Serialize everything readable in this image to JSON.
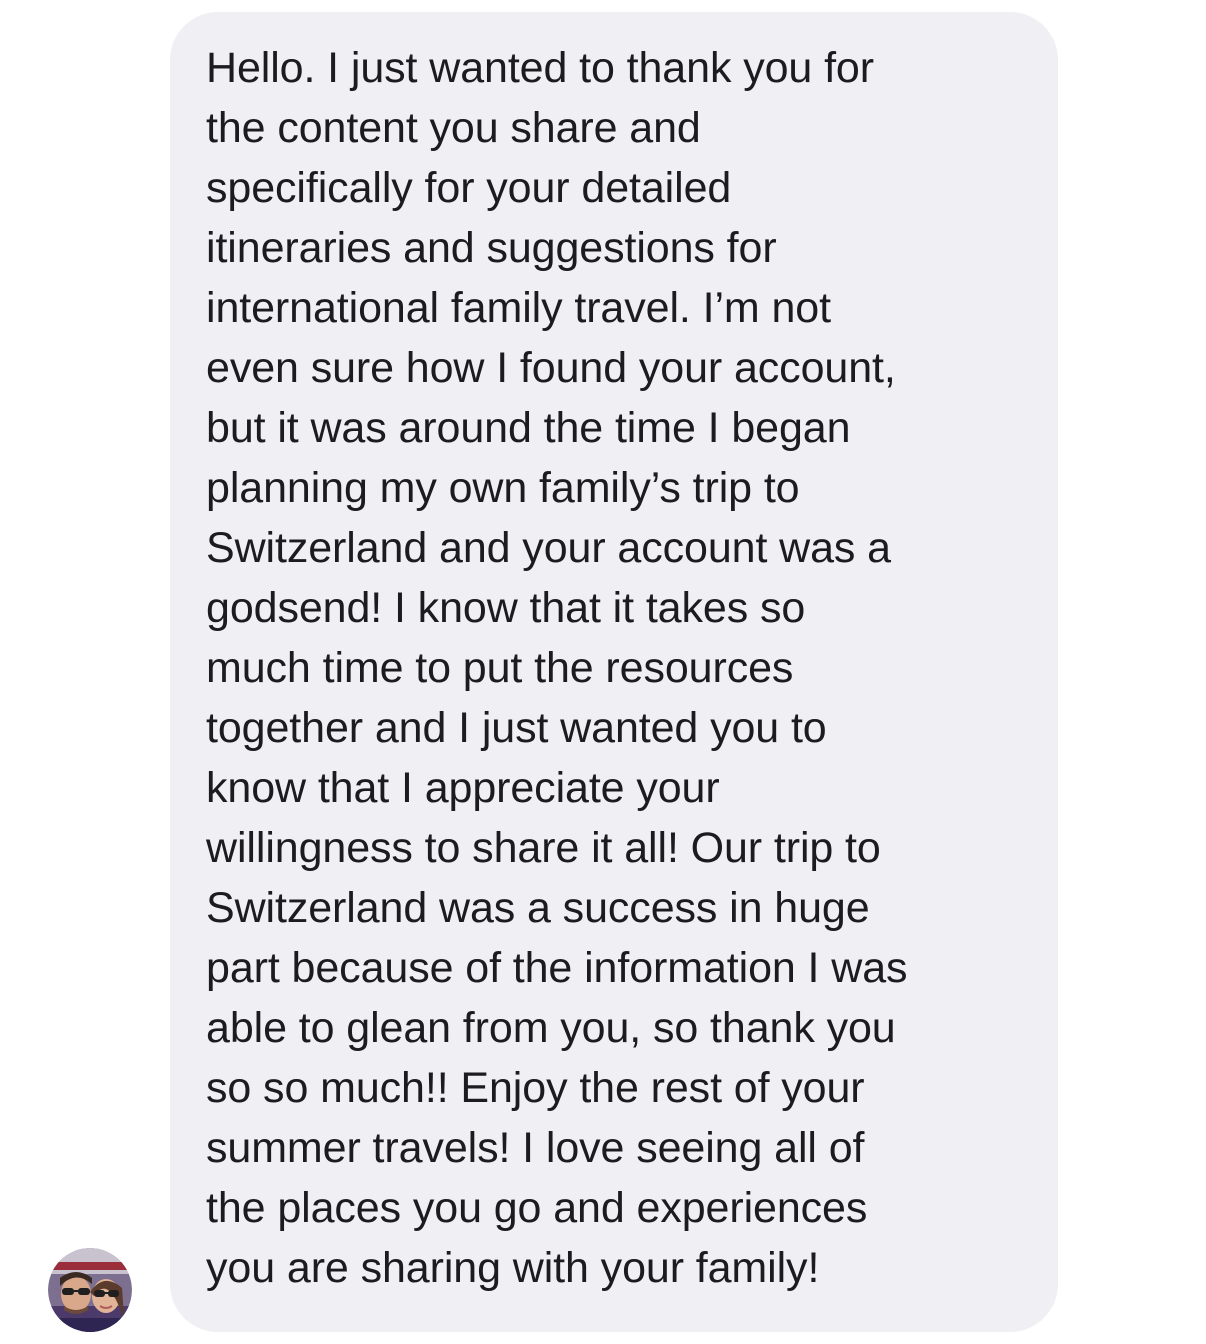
{
  "conversation": {
    "message": {
      "lines": [
        "Hello. I just wanted to thank you for",
        "the content you share and",
        "specifically for your detailed",
        "itineraries and suggestions for",
        "international family travel. I’m not",
        "even sure how I found your account,",
        "but it was around the time I began",
        "planning my own family’s trip to",
        "Switzerland and your account was a",
        "godsend! I know that it takes so",
        "much time to put the resources",
        "together and I just wanted you to",
        "know that I appreciate your",
        "willingness to share it all! Our trip to",
        "Switzerland was a success in huge",
        "part because of the information I was",
        "able to glean from you, so thank you",
        "so so much!! Enjoy the rest of your",
        "summer travels! I love seeing all of",
        "the places you go and experiences",
        "you are sharing with your family!"
      ],
      "bubble_color": "#efeff4",
      "text_color": "#1c1c1e"
    },
    "sender": {
      "avatar_icon": "profile-photo-avatar"
    }
  }
}
